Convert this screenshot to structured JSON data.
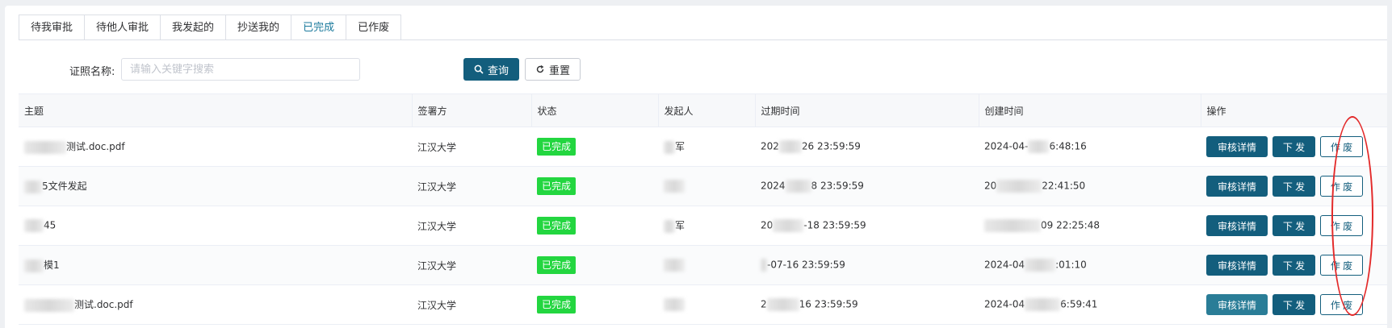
{
  "tabs": [
    "待我审批",
    "待他人审批",
    "我发起的",
    "抄送我的",
    "已完成",
    "已作废"
  ],
  "active_tab": "已完成",
  "search": {
    "label": "证照名称:",
    "placeholder": "请输入关键字搜索",
    "query_label": "查询",
    "reset_label": "重置"
  },
  "columns": [
    "主题",
    "签署方",
    "状态",
    "发起人",
    "过期时间",
    "创建时间",
    "操作"
  ],
  "rows": [
    {
      "subject": "测试.doc.pdf",
      "signer": "江汉大学",
      "status": "已完成",
      "initiator": "军",
      "expire": "26 23:59:59",
      "created": "6:48:16",
      "expire_prefix": "202",
      "created_prefix": "2024-04-"
    },
    {
      "subject": "5文件发起",
      "signer": "江汉大学",
      "status": "已完成",
      "initiator": "",
      "expire": "8 23:59:59",
      "created": "22:41:50",
      "expire_prefix": "2024",
      "created_prefix": "20"
    },
    {
      "subject": "45",
      "signer": "江汉大学",
      "status": "已完成",
      "initiator": "军",
      "expire": "-18 23:59:59",
      "created": "09 22:25:48",
      "expire_prefix": "20",
      "created_prefix": ""
    },
    {
      "subject": "模1",
      "signer": "江汉大学",
      "status": "已完成",
      "initiator": "",
      "expire": "-07-16 23:59:59",
      "created": ":01:10",
      "expire_prefix": "",
      "created_prefix": "2024-04"
    },
    {
      "subject": "测试.doc.pdf",
      "signer": "江汉大学",
      "status": "已完成",
      "initiator": "",
      "expire": "16 23:59:59",
      "created": "6:59:41",
      "expire_prefix": "2",
      "created_prefix": "2024-04"
    }
  ],
  "actions": {
    "detail": "审核详情",
    "send": "下 发",
    "void": "作 废"
  },
  "colors": {
    "primary": "#135e7d",
    "status_green": "#23d640",
    "annotation_red": "#e32a2a"
  }
}
